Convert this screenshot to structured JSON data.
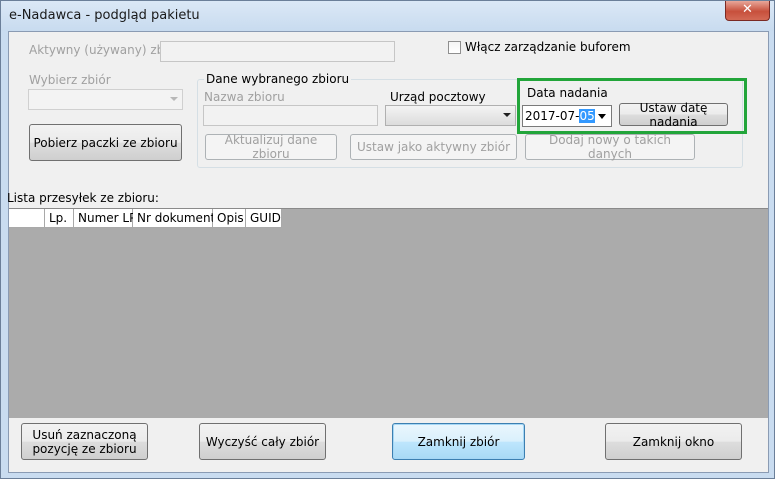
{
  "window": {
    "title": "e-Nadawca - podgląd pakietu",
    "close_glyph": "✕"
  },
  "active_set": {
    "label": "Aktywny (używany) zbiór",
    "value": ""
  },
  "buffer": {
    "label": "Włącz zarządzanie buforem",
    "checked": false
  },
  "choose_set": {
    "label": "Wybierz zbiór",
    "selected": ""
  },
  "fetch_button": "Pobierz paczki ze zbioru",
  "set_data": {
    "group_title": "Dane wybranego zbioru",
    "name_label": "Nazwa zbioru",
    "name_value": "",
    "post_office_label": "Urząd pocztowy",
    "post_office_selected": "",
    "update_button": "Aktualizuj dane zbioru",
    "set_active_button": "Ustaw jako aktywny zbiór",
    "add_new_button": "Dodaj nowy o takich danych"
  },
  "send_date": {
    "label": "Data nadania",
    "date_prefix": "2017-07-",
    "date_selected": "05",
    "set_button": "Ustaw datę nadania",
    "highlight_color": "#22a53a"
  },
  "list": {
    "label": "Lista przesyłek ze zbioru:",
    "columns": [
      "",
      "Lp.",
      "Numer LP",
      "Nr dokumentu",
      "Opis",
      "GUID"
    ]
  },
  "bottom": {
    "remove_line1": "Usuń zaznaczoną",
    "remove_line2": "pozycję ze zbioru",
    "clear_button": "Wyczyść cały zbiór",
    "close_set_button": "Zamknij zbiór",
    "close_window_button": "Zamknij okno"
  }
}
